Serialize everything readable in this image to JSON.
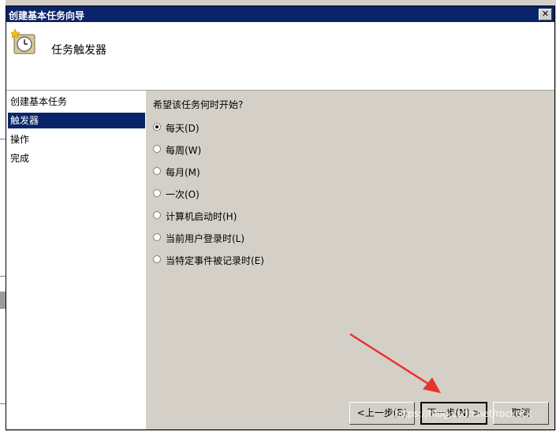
{
  "window": {
    "title": "创建基本任务向导",
    "close_glyph": "✕"
  },
  "header": {
    "title": "任务触发器",
    "icon": "clock-icon"
  },
  "sidebar": {
    "items": [
      {
        "label": "创建基本任务",
        "selected": false
      },
      {
        "label": "触发器",
        "selected": true
      },
      {
        "label": "操作",
        "selected": false
      },
      {
        "label": "完成",
        "selected": false
      }
    ]
  },
  "trigger": {
    "question": "希望该任务何时开始?",
    "options": [
      {
        "label": "每天(D)",
        "checked": true
      },
      {
        "label": "每周(W)",
        "checked": false
      },
      {
        "label": "每月(M)",
        "checked": false
      },
      {
        "label": "一次(O)",
        "checked": false
      },
      {
        "label": "计算机启动时(H)",
        "checked": false
      },
      {
        "label": "当前用户登录时(L)",
        "checked": false
      },
      {
        "label": "当特定事件被记录时(E)",
        "checked": false
      }
    ]
  },
  "buttons": {
    "back": "<上一步(B)",
    "next": "下一步(N) >",
    "cancel": "取消"
  },
  "watermark": "https://blog.csdn.net/rockeck",
  "colors": {
    "selection": "#0a246a",
    "arrow": "#e8322c",
    "dialog_bg": "#d4d0c8"
  }
}
